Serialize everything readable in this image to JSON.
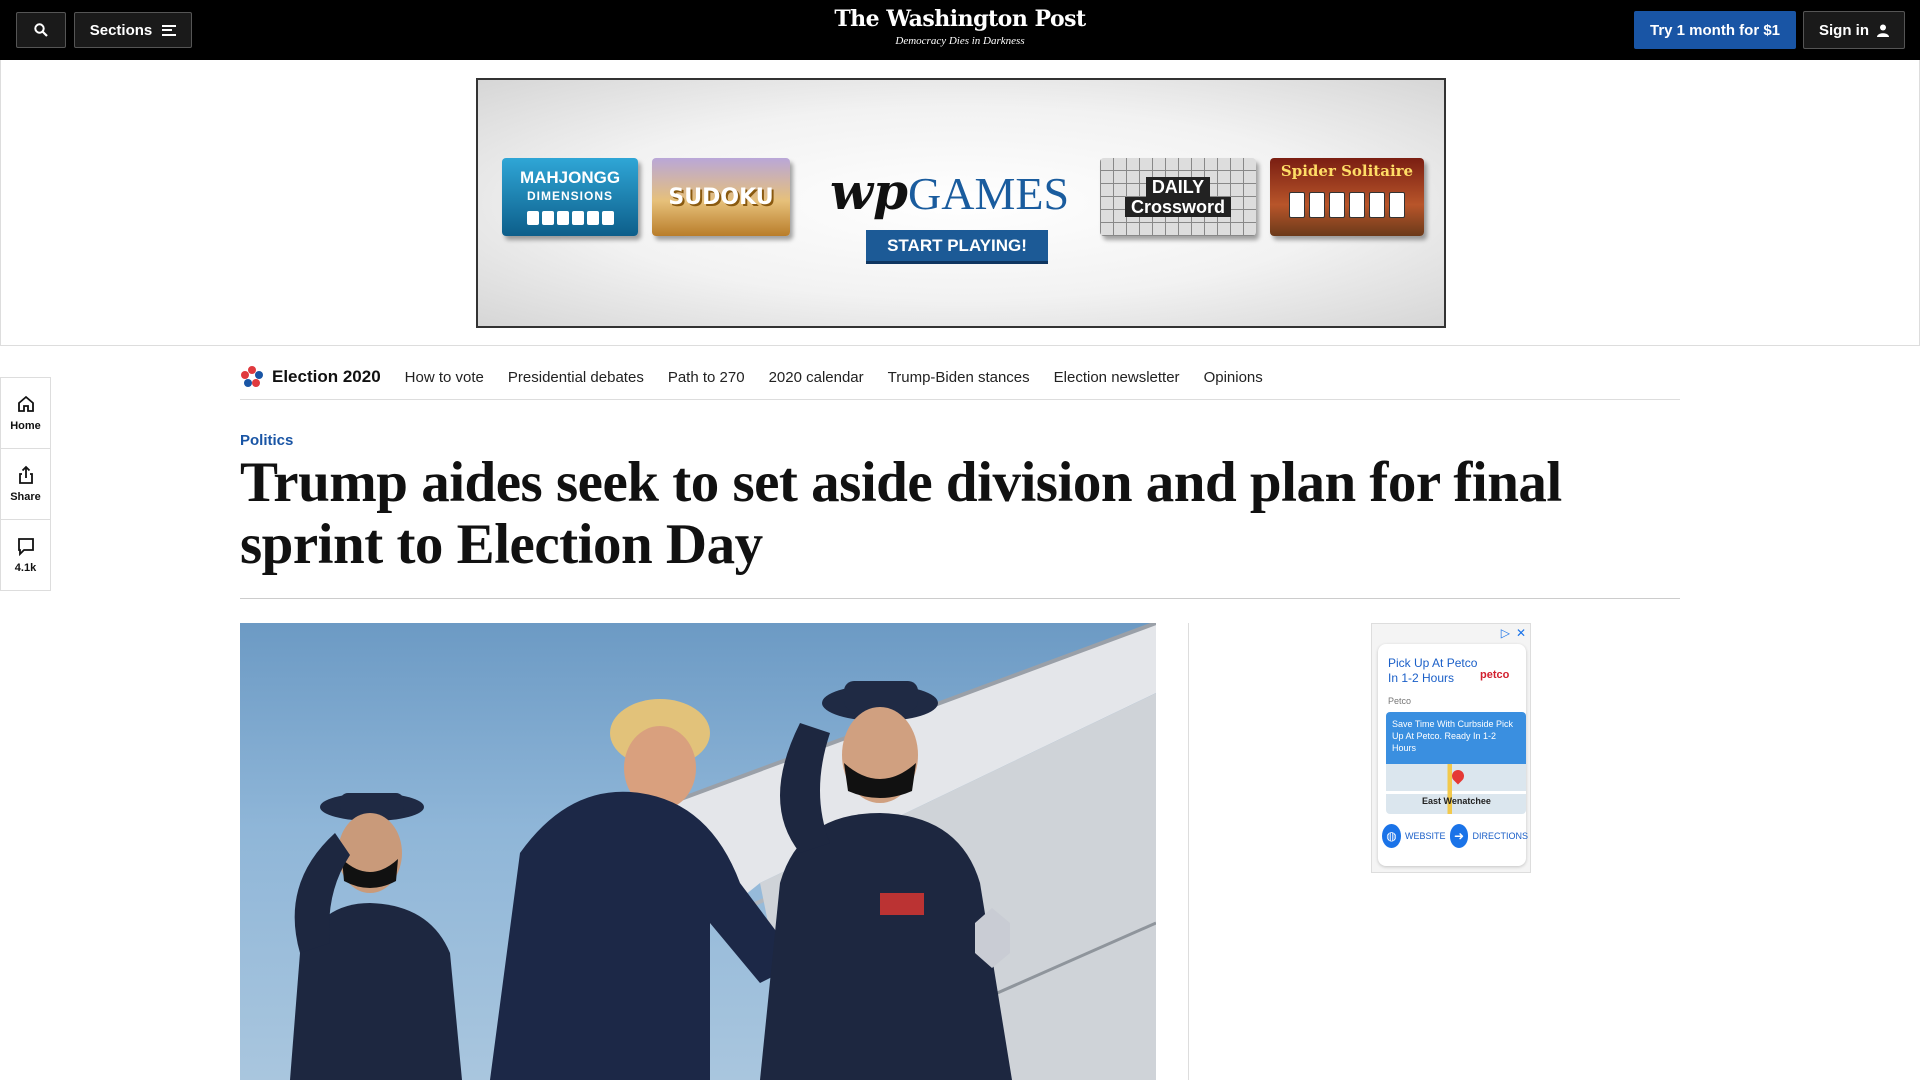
{
  "header": {
    "sections_label": "Sections",
    "logo": "The Washington Post",
    "tagline": "Democracy Dies in Darkness",
    "try_label": "Try 1 month for $1",
    "signin_label": "Sign in"
  },
  "top_ad": {
    "tiles": {
      "mahjong_line1": "MAHJONGG",
      "mahjong_line2": "DIMENSIONS",
      "sudoku": "SUDOKU",
      "crossword_line1": "DAILY",
      "crossword_line2": "Crossword",
      "spider": "Spider Solitaire"
    },
    "logo_wp": "wp",
    "logo_games": "GAMES",
    "cta": "START PLAYING!"
  },
  "rail": {
    "home": "Home",
    "share": "Share",
    "comments": "4.1k"
  },
  "election_nav": {
    "title": "Election 2020",
    "links": [
      "How to vote",
      "Presidential debates",
      "Path to 270",
      "2020 calendar",
      "Trump-Biden stances",
      "Election newsletter",
      "Opinions"
    ]
  },
  "article": {
    "kicker": "Politics",
    "headline": "Trump aides seek to set aside division and plan for final sprint to Election Day"
  },
  "side_ad": {
    "title": "Pick Up At Petco In 1-2 Hours",
    "brand": "petco",
    "advertiser": "Petco",
    "body": "Save Time With Curbside Pick Up At Petco. Ready In 1-2 Hours",
    "map_label": "East Wenatchee",
    "website_label": "WEBSITE",
    "directions_label": "DIRECTIONS"
  },
  "colors": {
    "accent_blue": "#1955a5",
    "topbar": "#000000"
  }
}
